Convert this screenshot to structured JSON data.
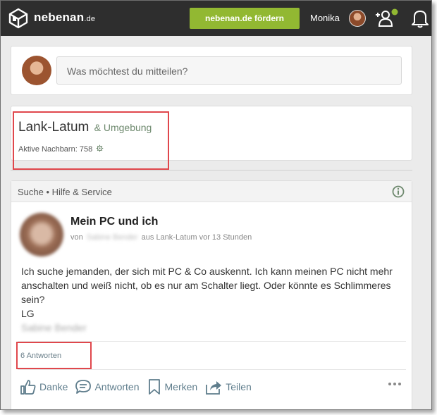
{
  "topbar": {
    "logo": "nebenan",
    "logo_tld": ".de",
    "promote_label": "nebenan.de fördern",
    "user_name": "Monika"
  },
  "composer": {
    "placeholder": "Was möchtest du mitteilen?"
  },
  "area": {
    "title": "Lank-Latum",
    "subtitle": "& Umgebung",
    "active_neighbors_label": "Aktive Nachbarn:",
    "active_neighbors_count": "758"
  },
  "post": {
    "category": "Suche • Hilfe & Service",
    "title": "Mein PC und ich",
    "meta_von": "von",
    "author_blurred": "Sabine Bender",
    "meta_rest": "aus Lank-Latum vor 13 Stunden",
    "body": "Ich suche jemanden, der sich mit PC & Co auskennt. Ich kann meinen PC nicht mehr anschalten und weiß nicht, ob es nur am Schalter liegt. Oder könnte es Schlimmeres sein?",
    "greeting": "LG",
    "signature_blurred": "Sabine Bender",
    "answers": "6 Antworten",
    "actions": {
      "thanks": "Danke",
      "reply": "Antworten",
      "bookmark": "Merken",
      "share": "Teilen"
    }
  },
  "colors": {
    "topbar": "#2e2e2e",
    "accent_green": "#92b832",
    "action_blue": "#5f7d8c",
    "highlight_red": "#e0474c"
  },
  "icons": [
    "logo-icon",
    "neighbors-add-icon",
    "bell-icon",
    "gear-icon",
    "info-icon",
    "thumbs-up-icon",
    "chat-icon",
    "bookmark-icon",
    "share-icon",
    "more-icon"
  ]
}
